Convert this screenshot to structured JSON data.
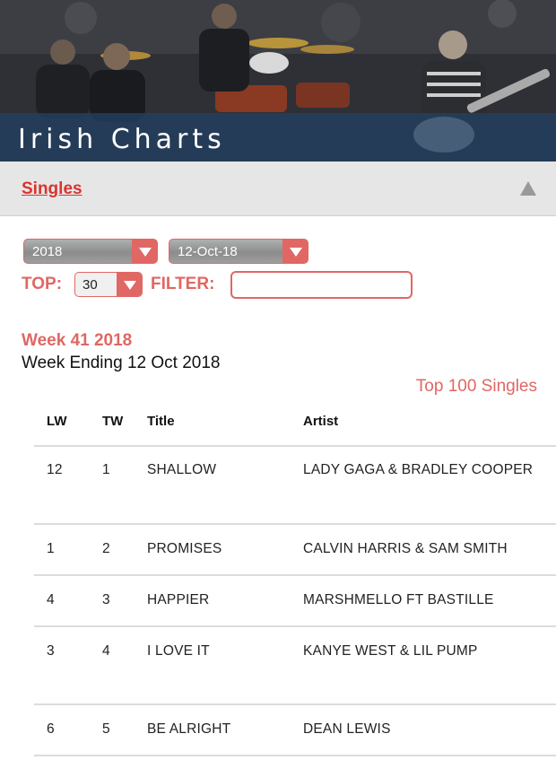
{
  "banner": {
    "title": "Irish Charts"
  },
  "section": {
    "link_label": "Singles"
  },
  "controls": {
    "year_value": "2018",
    "date_value": "12-Oct-18",
    "top_label": "TOP:",
    "top_value": "30",
    "filter_label": "FILTER:",
    "filter_value": ""
  },
  "week": {
    "title": "Week 41 2018",
    "ending": "Week Ending 12 Oct 2018",
    "top100_link": "Top 100 Singles"
  },
  "table": {
    "headers": {
      "lw": "LW",
      "tw": "TW",
      "title": "Title",
      "artist": "Artist"
    },
    "rows": [
      {
        "lw": "12",
        "tw": "1",
        "title": "SHALLOW",
        "artist": "LADY GAGA & BRADLEY COOPER"
      },
      {
        "lw": "1",
        "tw": "2",
        "title": "PROMISES",
        "artist": "CALVIN HARRIS & SAM SMITH"
      },
      {
        "lw": "4",
        "tw": "3",
        "title": "HAPPIER",
        "artist": "MARSHMELLO FT BASTILLE"
      },
      {
        "lw": "3",
        "tw": "4",
        "title": "I LOVE IT",
        "artist": "KANYE WEST & LIL PUMP"
      },
      {
        "lw": "6",
        "tw": "5",
        "title": "BE ALRIGHT",
        "artist": "DEAN LEWIS"
      }
    ]
  },
  "colors": {
    "accent": "#e06763",
    "link": "#d8342f",
    "banner_bar": "#224062"
  }
}
